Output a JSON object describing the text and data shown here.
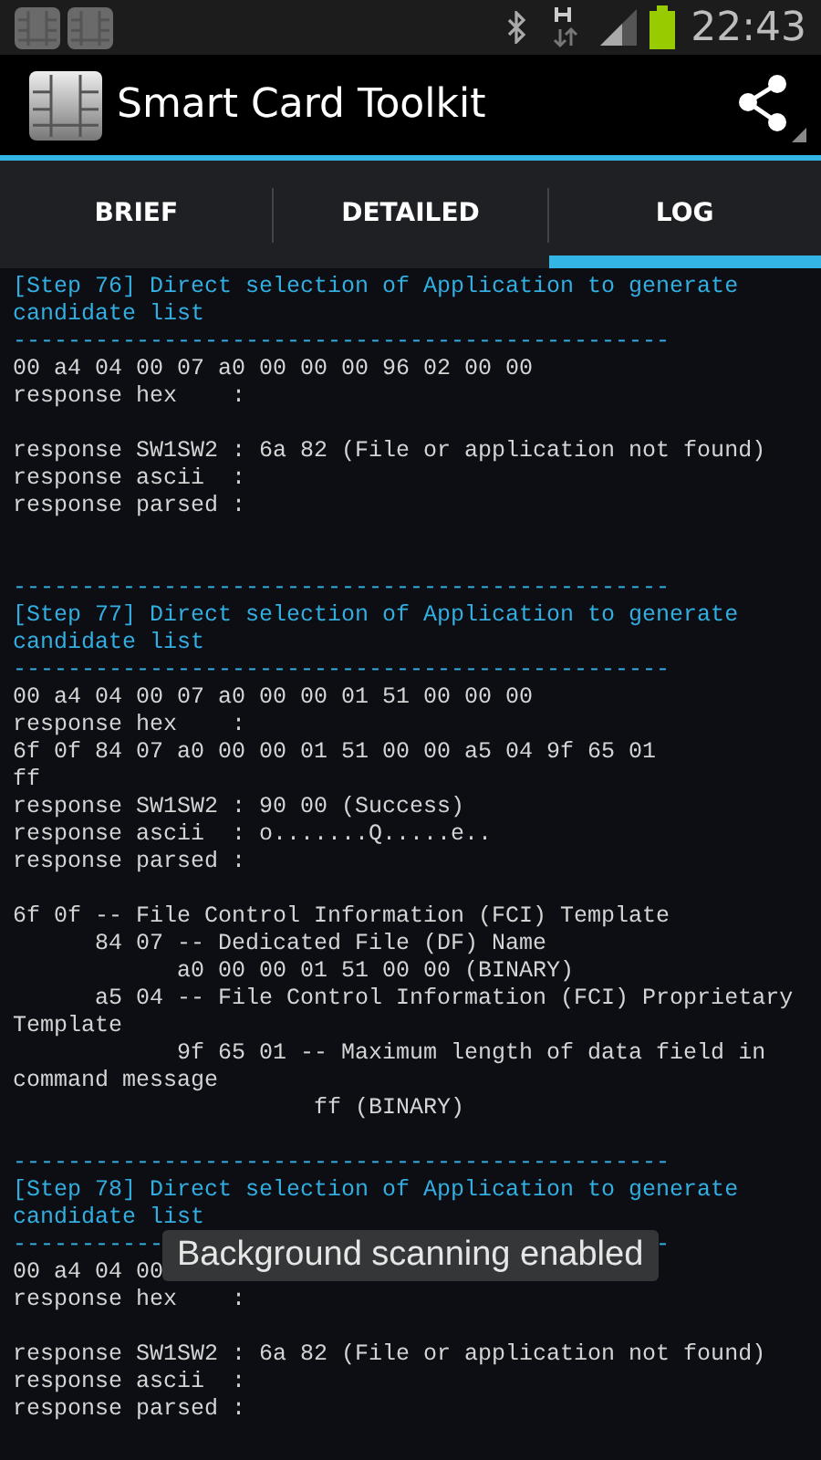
{
  "status_bar": {
    "time": "22:43"
  },
  "action_bar": {
    "title": "Smart Card Toolkit"
  },
  "tabs": [
    {
      "label": "BRIEF",
      "selected": false
    },
    {
      "label": "DETAILED",
      "selected": false
    },
    {
      "label": "LOG",
      "selected": true
    }
  ],
  "log": [
    {
      "kind": "header",
      "text": "[Step 76] Direct selection of Application to generate"
    },
    {
      "kind": "header",
      "text": "candidate list"
    },
    {
      "kind": "rule",
      "text": "------------------------------------------------"
    },
    {
      "kind": "text",
      "text": "00 a4 04 00 07 a0 00 00 00 96 02 00 00"
    },
    {
      "kind": "text",
      "text": "response hex    :"
    },
    {
      "kind": "blank"
    },
    {
      "kind": "text",
      "text": "response SW1SW2 : 6a 82 (File or application not found)"
    },
    {
      "kind": "text",
      "text": "response ascii  :"
    },
    {
      "kind": "text",
      "text": "response parsed :"
    },
    {
      "kind": "blank"
    },
    {
      "kind": "blank"
    },
    {
      "kind": "rule",
      "text": "------------------------------------------------"
    },
    {
      "kind": "header",
      "text": "[Step 77] Direct selection of Application to generate"
    },
    {
      "kind": "header",
      "text": "candidate list"
    },
    {
      "kind": "rule",
      "text": "------------------------------------------------"
    },
    {
      "kind": "text",
      "text": "00 a4 04 00 07 a0 00 00 01 51 00 00 00"
    },
    {
      "kind": "text",
      "text": "response hex    :"
    },
    {
      "kind": "text",
      "text": "6f 0f 84 07 a0 00 00 01 51 00 00 a5 04 9f 65 01"
    },
    {
      "kind": "text",
      "text": "ff"
    },
    {
      "kind": "text",
      "text": "response SW1SW2 : 90 00 (Success)"
    },
    {
      "kind": "text",
      "text": "response ascii  : o.......Q.....e.."
    },
    {
      "kind": "text",
      "text": "response parsed :"
    },
    {
      "kind": "blank"
    },
    {
      "kind": "text",
      "text": "6f 0f -- File Control Information (FCI) Template"
    },
    {
      "kind": "text",
      "text": "      84 07 -- Dedicated File (DF) Name"
    },
    {
      "kind": "text",
      "text": "            a0 00 00 01 51 00 00 (BINARY)"
    },
    {
      "kind": "text",
      "text": "      a5 04 -- File Control Information (FCI) Proprietary"
    },
    {
      "kind": "text",
      "text": "Template"
    },
    {
      "kind": "text",
      "text": "            9f 65 01 -- Maximum length of data field in"
    },
    {
      "kind": "text",
      "text": "command message"
    },
    {
      "kind": "text",
      "text": "                      ff (BINARY)"
    },
    {
      "kind": "blank"
    },
    {
      "kind": "rule",
      "text": "------------------------------------------------"
    },
    {
      "kind": "header",
      "text": "[Step 78] Direct selection of Application to generate"
    },
    {
      "kind": "header",
      "text": "candidate list"
    },
    {
      "kind": "rule",
      "text": "-----------",
      "tail": "-"
    },
    {
      "kind": "text",
      "text": "00 a4 04 00"
    },
    {
      "kind": "text",
      "text": "response hex    :"
    },
    {
      "kind": "blank"
    },
    {
      "kind": "text",
      "text": "response SW1SW2 : 6a 82 (File or application not found)"
    },
    {
      "kind": "text",
      "text": "response ascii  :"
    },
    {
      "kind": "text",
      "text": "response parsed :"
    }
  ],
  "toast": {
    "text": "Background scanning enabled"
  }
}
